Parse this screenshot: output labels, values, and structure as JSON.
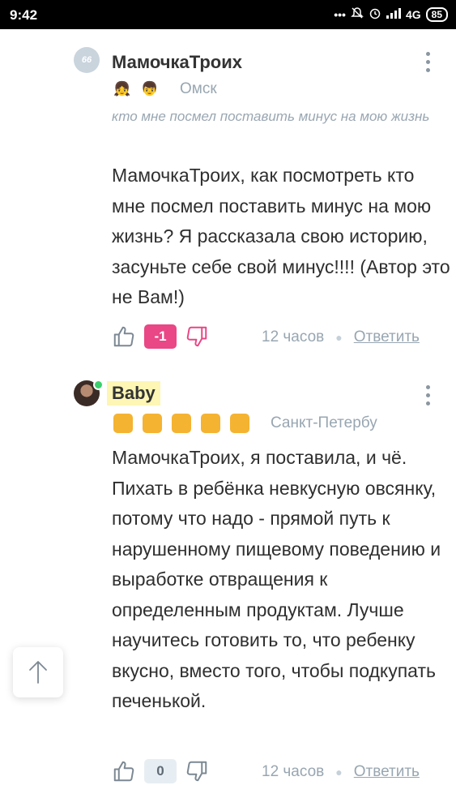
{
  "status_bar": {
    "time": "9:42",
    "network": "4G",
    "battery": "85"
  },
  "comments": [
    {
      "author": "МамочкаТроих",
      "avatar_text": "66",
      "city": "Омск",
      "quote": "кто мне посмел поставить минус на мою жизнь",
      "text": "МамочкаТроих, как посмотреть кто мне посмел поставить минус на мою жизнь? Я рассказала свою историю, засуньте себе свой минус!!!! (Автор это не Вам!)",
      "score": "-1",
      "time": "12 часов",
      "reply_label": "Ответить"
    },
    {
      "author": "Baby",
      "city": "Санкт-Петербу",
      "text": "МамочкаТроих, я поставила, и чё. Пихать в ребёнка невкусную овсянку, потому что надо - прямой путь к нарушенному пищевому поведению и выработке отвращения к определенным продуктам. Лучше научитесь готовить то, что ребенку вкусно, вместо того, чтобы подкупать печенькой.",
      "score": "0",
      "time": "12 часов",
      "reply_label": "Ответить"
    }
  ],
  "colors": {
    "negative_score": "#e94785",
    "badge_orange": "#f5b332",
    "meta_grey": "#98a6b1"
  }
}
